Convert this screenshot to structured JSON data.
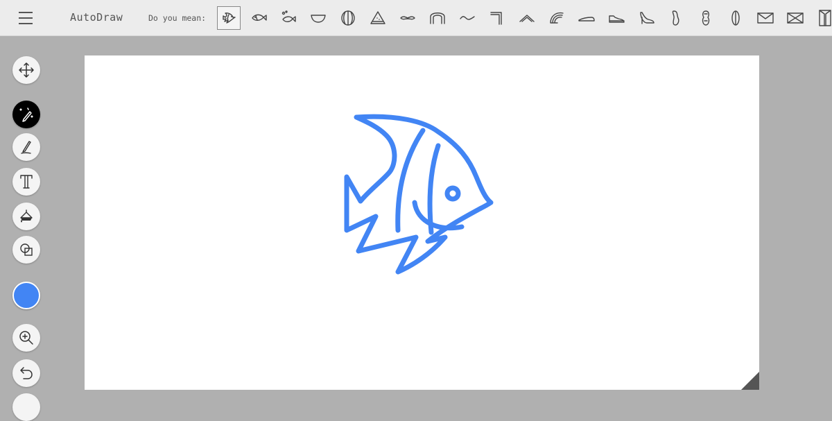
{
  "app": {
    "title": "AutoDraw"
  },
  "suggestions": {
    "label": "Do you mean:",
    "items": [
      {
        "icon": "angelfish-icon",
        "selected": true
      },
      {
        "icon": "fish-icon",
        "selected": false
      },
      {
        "icon": "fish-bubbles-icon",
        "selected": false
      },
      {
        "icon": "bowl-icon",
        "selected": false
      },
      {
        "icon": "ball-icon",
        "selected": false
      },
      {
        "icon": "watermelon-slice-icon",
        "selected": false
      },
      {
        "icon": "mustache-icon",
        "selected": false
      },
      {
        "icon": "arch-icon",
        "selected": false
      },
      {
        "icon": "squiggle-icon",
        "selected": false
      },
      {
        "icon": "corner-icon",
        "selected": false
      },
      {
        "icon": "chevron-icon",
        "selected": false
      },
      {
        "icon": "rainbow-icon",
        "selected": false
      },
      {
        "icon": "flat-shoe-icon",
        "selected": false
      },
      {
        "icon": "sneaker-icon",
        "selected": false
      },
      {
        "icon": "high-heel-icon",
        "selected": false
      },
      {
        "icon": "blob-icon",
        "selected": false
      },
      {
        "icon": "peanut-icon",
        "selected": false
      },
      {
        "icon": "leaf-icon",
        "selected": false
      },
      {
        "icon": "envelope-icon",
        "selected": false
      },
      {
        "icon": "envelope-crossed-icon",
        "selected": false
      },
      {
        "icon": "door-icon",
        "selected": false
      }
    ]
  },
  "tools": [
    {
      "name": "move-tool",
      "icon": "move-icon",
      "active": false
    },
    {
      "name": "autodraw-tool",
      "icon": "magic-pencil-icon",
      "active": true
    },
    {
      "name": "draw-tool",
      "icon": "pencil-icon",
      "active": false
    },
    {
      "name": "text-tool",
      "icon": "text-icon",
      "active": false
    },
    {
      "name": "fill-tool",
      "icon": "paint-bucket-icon",
      "active": false
    },
    {
      "name": "shape-tool",
      "icon": "shapes-icon",
      "active": false
    },
    {
      "name": "zoom-tool",
      "icon": "zoom-in-icon",
      "active": false
    },
    {
      "name": "undo-tool",
      "icon": "undo-icon",
      "active": false
    }
  ],
  "colors": {
    "current": "#4285f4",
    "drawing_stroke": "#4285f4"
  }
}
